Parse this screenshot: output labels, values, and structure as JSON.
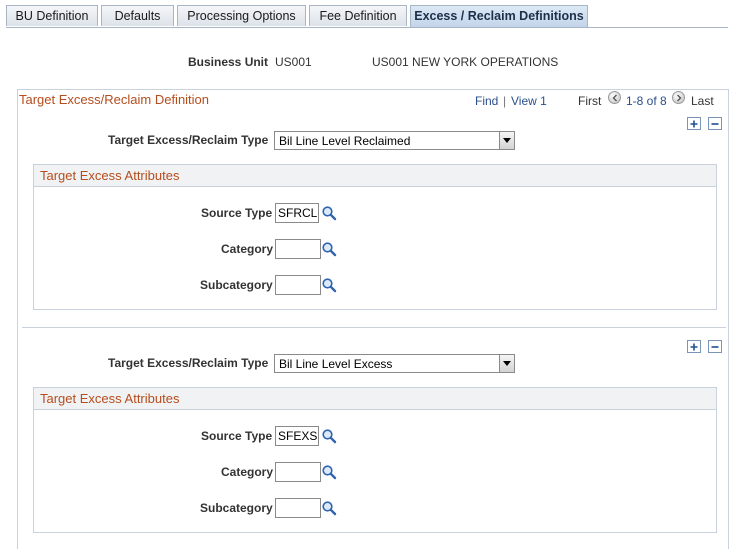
{
  "tabs": [
    {
      "label": "BU Definition",
      "active": false
    },
    {
      "label": "Defaults",
      "active": false
    },
    {
      "label": "Processing Options",
      "active": false
    },
    {
      "label": "Fee Definition",
      "active": false
    },
    {
      "label": "Excess / Reclaim Definitions",
      "active": true
    }
  ],
  "header": {
    "business_unit_label": "Business Unit",
    "business_unit_code": "US001",
    "business_unit_description": "US001 NEW YORK OPERATIONS"
  },
  "scroll": {
    "title": "Target Excess/Reclaim Definition",
    "find": "Find",
    "view": "View 1",
    "separator": "|",
    "first": "First",
    "range": "1-8 of 8",
    "last": "Last",
    "rows": [
      {
        "type_label": "Target Excess/Reclaim Type",
        "type_value": "Bil Line Level Reclaimed",
        "group_title": "Target Excess Attributes",
        "source_type_label": "Source Type",
        "source_type_value": "SFRCL",
        "category_label": "Category",
        "category_value": "",
        "subcategory_label": "Subcategory",
        "subcategory_value": ""
      },
      {
        "type_label": "Target Excess/Reclaim Type",
        "type_value": "Bil Line Level Excess",
        "group_title": "Target Excess Attributes",
        "source_type_label": "Source Type",
        "source_type_value": "SFEXS",
        "category_label": "Category",
        "category_value": "",
        "subcategory_label": "Subcategory",
        "subcategory_value": ""
      }
    ]
  },
  "icons": {
    "add": "plus-icon",
    "delete": "minus-icon",
    "lookup": "magnifier-icon",
    "previous": "chevron-left-icon",
    "next": "chevron-right-icon",
    "dropdown": "chevron-down-icon"
  },
  "colors": {
    "section_title": "#b64d1e",
    "link": "#2a4f8a",
    "active_tab": "#c3d5ea",
    "border": "#c9d2dc"
  }
}
